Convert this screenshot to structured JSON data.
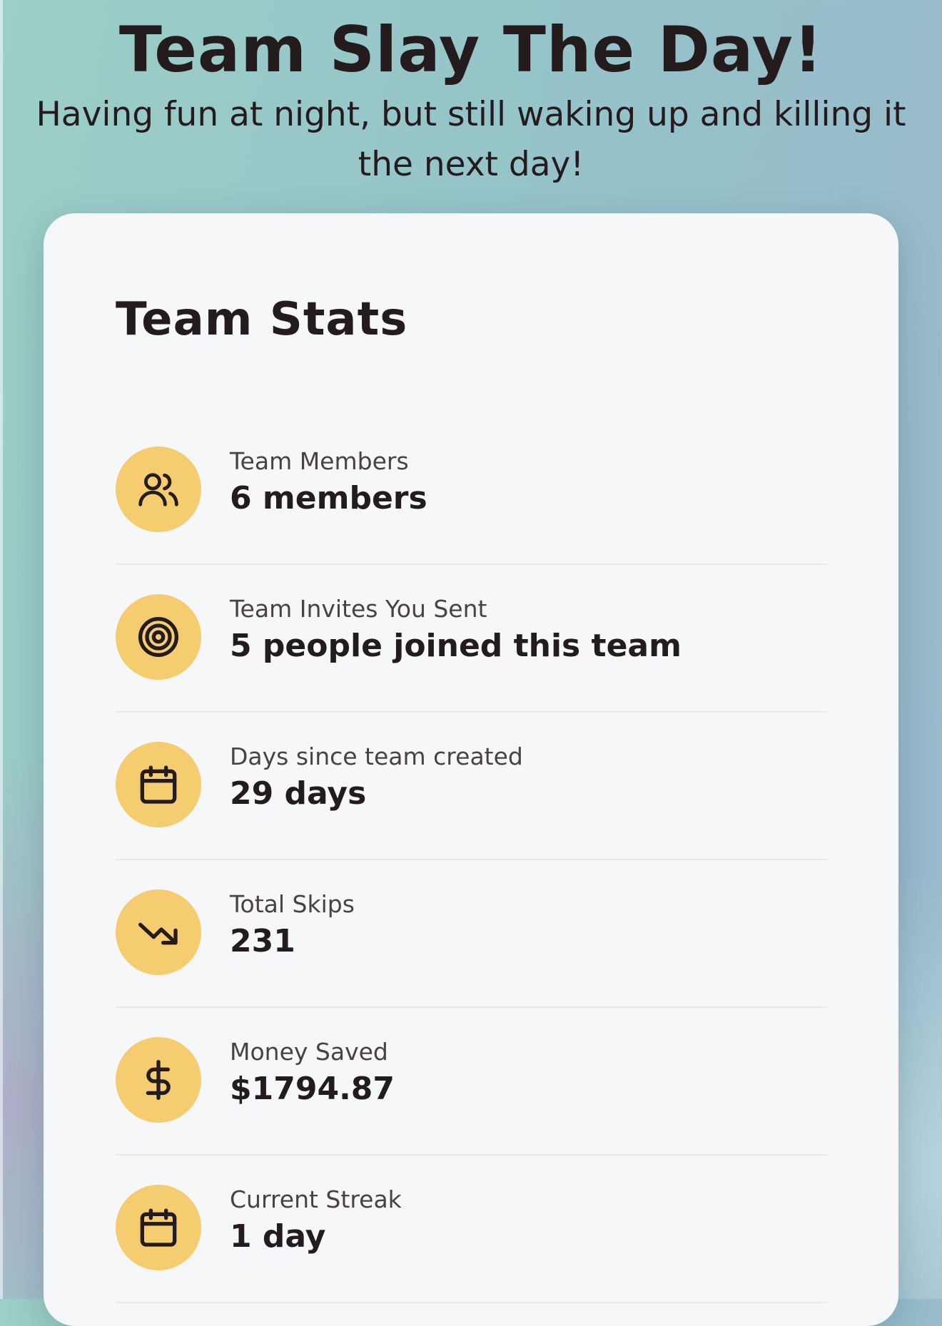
{
  "header": {
    "title": "Team Slay The Day!",
    "subtitle": "Having fun at night, but still waking up and killing it the next day!"
  },
  "stats_card": {
    "title": "Team Stats",
    "accent_color": "#f6cc70",
    "items": [
      {
        "icon": "users-icon",
        "label": "Team Members",
        "value": "6 members"
      },
      {
        "icon": "target-icon",
        "label": "Team Invites You Sent",
        "value": "5 people joined this team"
      },
      {
        "icon": "calendar-icon",
        "label": "Days since team created",
        "value": "29 days"
      },
      {
        "icon": "trending-down-icon",
        "label": "Total Skips",
        "value": "231"
      },
      {
        "icon": "dollar-icon",
        "label": "Money Saved",
        "value": "$1794.87"
      },
      {
        "icon": "calendar-icon",
        "label": "Current Streak",
        "value": "1 day"
      }
    ]
  }
}
